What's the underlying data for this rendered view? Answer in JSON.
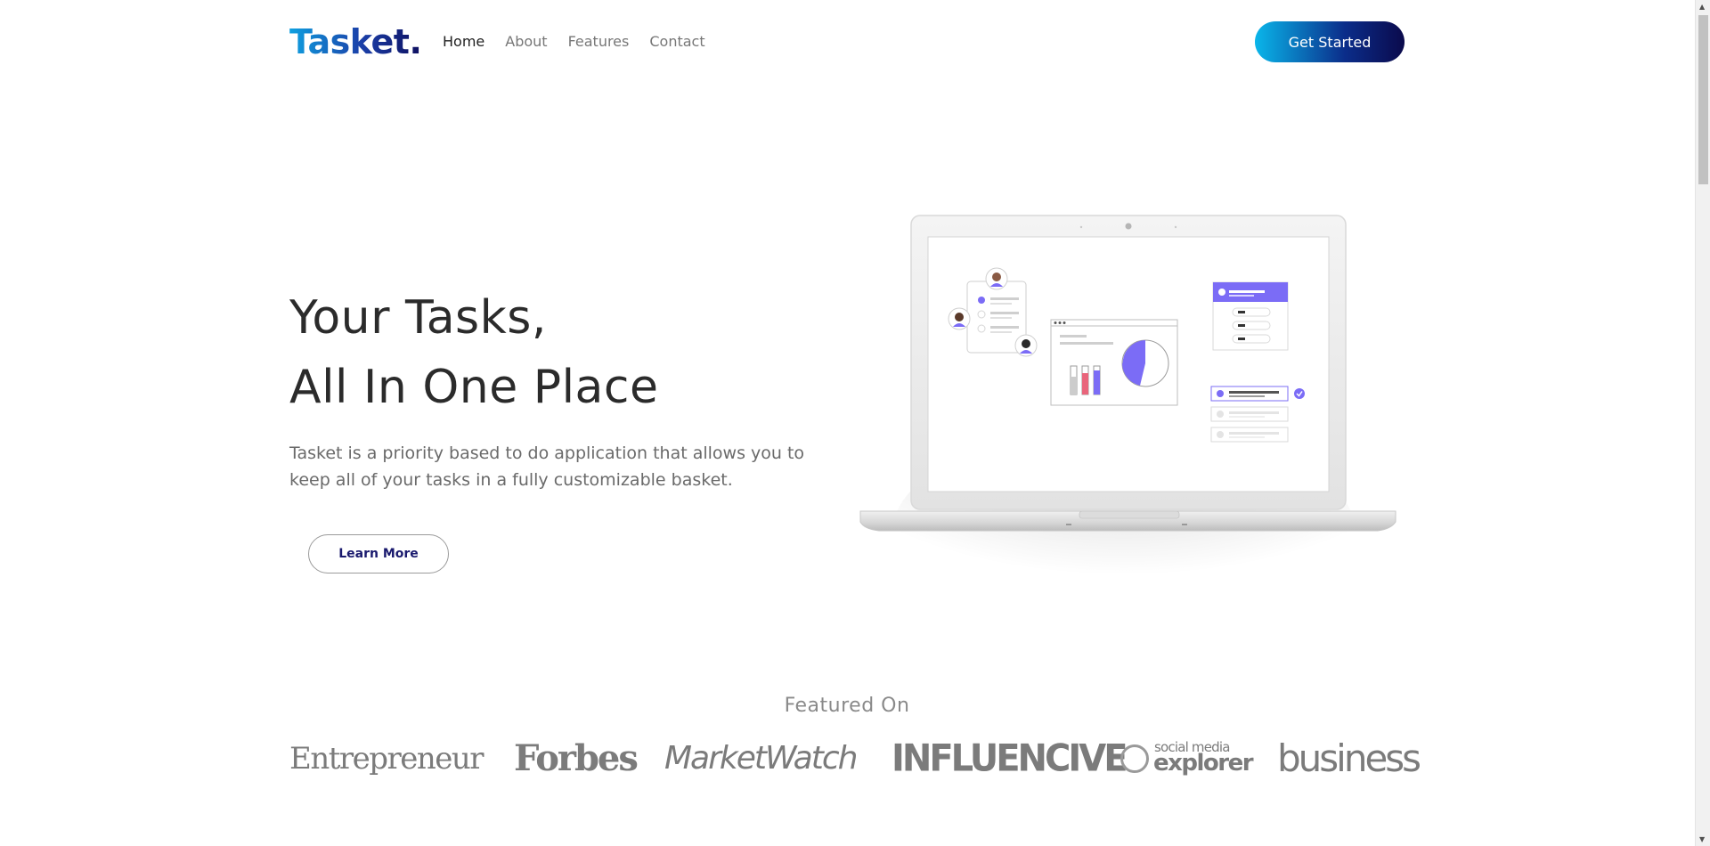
{
  "header": {
    "logo": "Tasket.",
    "nav": [
      {
        "label": "Home",
        "active": true
      },
      {
        "label": "About",
        "active": false
      },
      {
        "label": "Features",
        "active": false
      },
      {
        "label": "Contact",
        "active": false
      }
    ],
    "cta_label": "Get Started"
  },
  "hero": {
    "title_line1": "Your Tasks,",
    "title_line2": "All In One Place",
    "description": "Tasket is a priority based to do application that allows you to keep all of your tasks in a fully customizable basket.",
    "learn_more_label": "Learn More"
  },
  "featured": {
    "title": "Featured On",
    "brands": {
      "entrepreneur": "Entrepreneur",
      "forbes": "Forbes",
      "marketwatch": "MarketWatch",
      "influencive": "INFLUENCIVE",
      "sme_top": "social media",
      "sme_bottom": "explorer",
      "business": "business"
    }
  },
  "colors": {
    "accent_purple": "#7b6cf6",
    "accent_pink": "#e9657b",
    "gradient_start": "#0ab6ea",
    "gradient_end": "#0b0a4c"
  }
}
